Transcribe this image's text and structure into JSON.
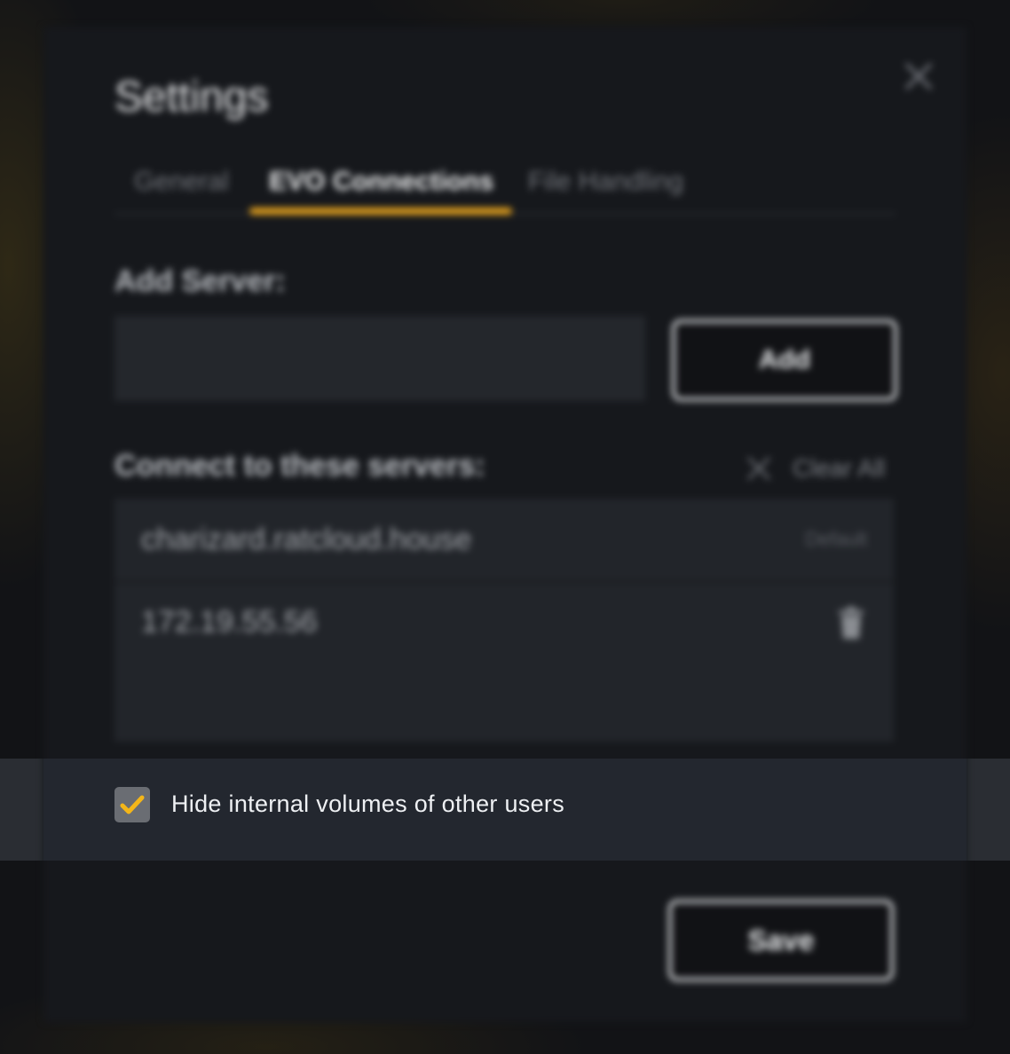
{
  "dialog": {
    "title": "Settings",
    "tabs": [
      {
        "label": "General"
      },
      {
        "label": "EVO Connections"
      },
      {
        "label": "File Handling"
      }
    ],
    "add_server_label": "Add Server:",
    "add_server_input_value": "",
    "add_button_label": "Add",
    "connect_label": "Connect to these servers:",
    "clear_all_label": "Clear All",
    "servers": [
      {
        "host": "charizard.ratcloud.house",
        "badge": "Default"
      },
      {
        "host": "172.19.55.56",
        "action_icon": "trash-icon"
      }
    ],
    "hide_internal_volumes": {
      "label": "Hide internal volumes of other users",
      "checked": true
    },
    "save_button_label": "Save"
  },
  "colors": {
    "accent": "#e6a21d",
    "dialog_bg": "#16181c",
    "highlight_bg": "#23272f"
  }
}
